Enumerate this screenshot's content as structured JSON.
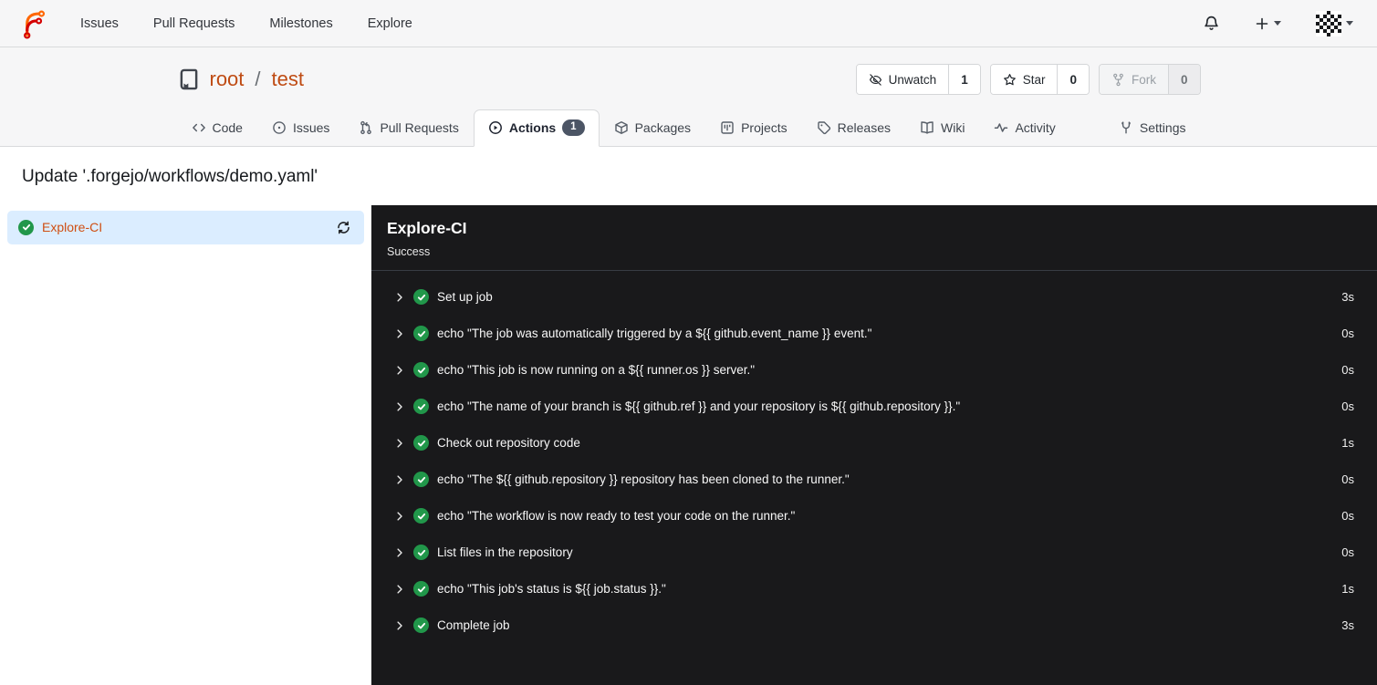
{
  "navbar": {
    "items": [
      {
        "label": "Issues"
      },
      {
        "label": "Pull Requests"
      },
      {
        "label": "Milestones"
      },
      {
        "label": "Explore"
      }
    ]
  },
  "repo": {
    "owner": "root",
    "separator": "/",
    "name": "test",
    "actions": {
      "unwatch": {
        "label": "Unwatch",
        "count": "1"
      },
      "star": {
        "label": "Star",
        "count": "0"
      },
      "fork": {
        "label": "Fork",
        "count": "0"
      }
    },
    "tabs": [
      {
        "label": "Code"
      },
      {
        "label": "Issues"
      },
      {
        "label": "Pull Requests"
      },
      {
        "label": "Actions",
        "badge": "1"
      },
      {
        "label": "Packages"
      },
      {
        "label": "Projects"
      },
      {
        "label": "Releases"
      },
      {
        "label": "Wiki"
      },
      {
        "label": "Activity"
      },
      {
        "label": "Settings"
      }
    ]
  },
  "run": {
    "title": "Update '.forgejo/workflows/demo.yaml'",
    "job": {
      "name": "Explore-CI",
      "status": "Success"
    },
    "steps": [
      {
        "name": "Set up job",
        "duration": "3s"
      },
      {
        "name": "echo \"The job was automatically triggered by a ${{ github.event_name }} event.\"",
        "duration": "0s"
      },
      {
        "name": "echo \"This job is now running on a ${{ runner.os }} server.\"",
        "duration": "0s"
      },
      {
        "name": "echo \"The name of your branch is ${{ github.ref }} and your repository is ${{ github.repository }}.\"",
        "duration": "0s"
      },
      {
        "name": "Check out repository code",
        "duration": "1s"
      },
      {
        "name": "echo \"The ${{ github.repository }} repository has been cloned to the runner.\"",
        "duration": "0s"
      },
      {
        "name": "echo \"The workflow is now ready to test your code on the runner.\"",
        "duration": "0s"
      },
      {
        "name": "List files in the repository",
        "duration": "0s"
      },
      {
        "name": "echo \"This job's status is ${{ job.status }}.\"",
        "duration": "1s"
      },
      {
        "name": "Complete job",
        "duration": "3s"
      }
    ]
  },
  "colors": {
    "accent_link": "#bf4b13",
    "job_link": "#cf4e12",
    "success_green": "#21974a",
    "selected_job_bg": "#dbedff",
    "panel_bg": "#19191b",
    "tab_badge_bg": "#4c5565"
  },
  "icons": {
    "logo": "forgejo-logo",
    "notifications": "bell",
    "create_new": "plus + caret-down",
    "user_menu": "identicon avatar + caret-down",
    "repo": "book",
    "unwatch": "eye-slash",
    "star": "star-outline",
    "fork": "git-fork",
    "tab_icons": "code, issue-circle, pull-request, play-circle, package-cube, project-board, tag, open-book, pulse, wrench",
    "job_status": "check-circle",
    "refresh": "sync-arrows",
    "step_expand": "chevron-right"
  }
}
